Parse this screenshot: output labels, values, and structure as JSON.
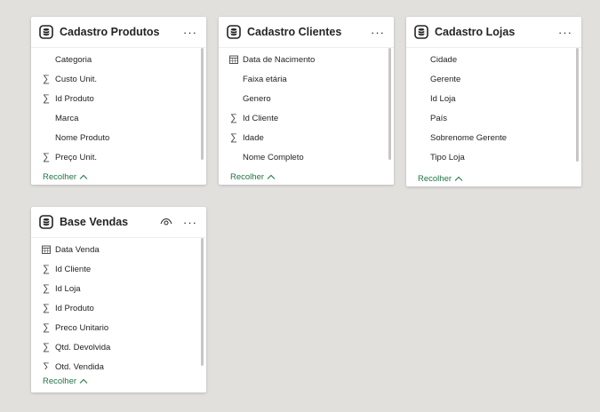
{
  "tables": [
    {
      "title": "Cadastro Produtos",
      "fields": [
        {
          "name": "Categoria",
          "icon": "none"
        },
        {
          "name": "Custo Unit.",
          "icon": "sigma-icon"
        },
        {
          "name": "Id Produto",
          "icon": "sigma-icon"
        },
        {
          "name": "Marca",
          "icon": "none"
        },
        {
          "name": "Nome Produto",
          "icon": "none"
        },
        {
          "name": "Preço Unit.",
          "icon": "sigma-icon"
        }
      ],
      "collapse_label": "Recolher"
    },
    {
      "title": "Cadastro Clientes",
      "fields": [
        {
          "name": "Data de Nacimento",
          "icon": "calendar-icon"
        },
        {
          "name": "Faixa etária",
          "icon": "none"
        },
        {
          "name": "Genero",
          "icon": "none"
        },
        {
          "name": "Id Cliente",
          "icon": "sigma-icon"
        },
        {
          "name": "Idade",
          "icon": "sigma-icon"
        },
        {
          "name": "Nome Completo",
          "icon": "none"
        }
      ],
      "collapse_label": "Recolher"
    },
    {
      "title": "Cadastro Lojas",
      "fields": [
        {
          "name": "Cidade",
          "icon": "none"
        },
        {
          "name": "Gerente",
          "icon": "none"
        },
        {
          "name": "Id Loja",
          "icon": "none"
        },
        {
          "name": "País",
          "icon": "none"
        },
        {
          "name": "Sobrenome Gerente",
          "icon": "none"
        },
        {
          "name": "Tipo Loja",
          "icon": "none"
        }
      ],
      "collapse_label": "Recolher"
    },
    {
      "title": "Base Vendas",
      "fields": [
        {
          "name": "Data Venda",
          "icon": "calendar-icon"
        },
        {
          "name": "Id Cliente",
          "icon": "sigma-icon"
        },
        {
          "name": "Id Loja",
          "icon": "sigma-icon"
        },
        {
          "name": "Id Produto",
          "icon": "sigma-icon"
        },
        {
          "name": "Preco Unitario",
          "icon": "sigma-icon"
        },
        {
          "name": "Qtd. Devolvida",
          "icon": "sigma-icon"
        },
        {
          "name": "Qtd. Vendida",
          "icon": "sigma-icon"
        }
      ],
      "collapse_label": "Recolher"
    }
  ],
  "colors": {
    "canvas": "#e1e0dd",
    "card": "#ffffff",
    "link": "#217346",
    "text": "#252423"
  }
}
